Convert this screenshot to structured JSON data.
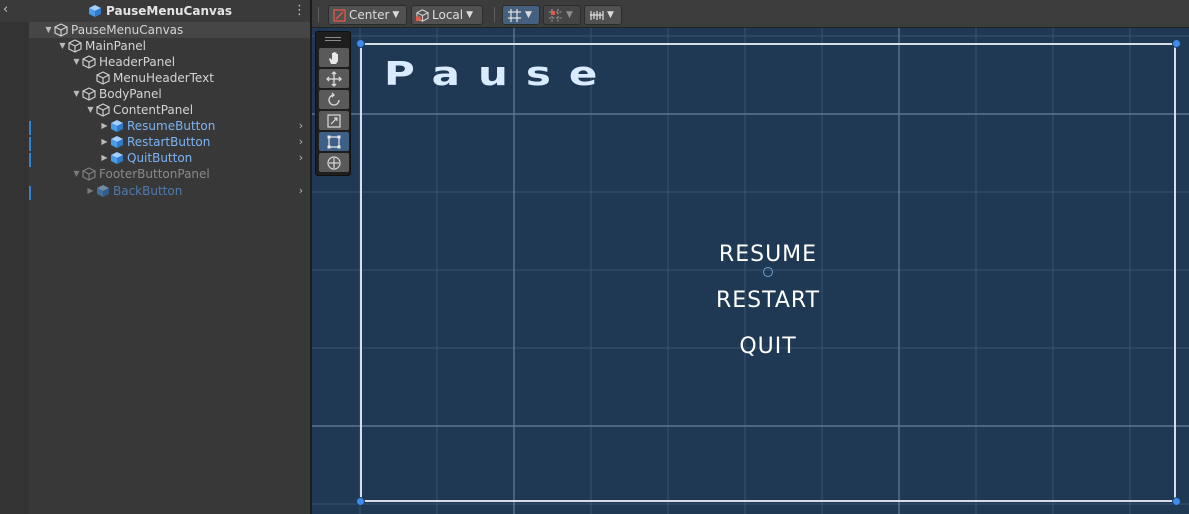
{
  "hierarchy": {
    "title": "PauseMenuCanvas",
    "rows": [
      {
        "label": "PauseMenuCanvas"
      },
      {
        "label": "MainPanel"
      },
      {
        "label": "HeaderPanel"
      },
      {
        "label": "MenuHeaderText"
      },
      {
        "label": "BodyPanel"
      },
      {
        "label": "ContentPanel"
      },
      {
        "label": "ResumeButton"
      },
      {
        "label": "RestartButton"
      },
      {
        "label": "QuitButton"
      },
      {
        "label": "FooterButtonPanel"
      },
      {
        "label": "BackButton"
      }
    ]
  },
  "toolbar": {
    "pivot_label": "Center",
    "space_label": "Local"
  },
  "scene": {
    "header_text": "Pause",
    "buttons": [
      "RESUME",
      "RESTART",
      "QUIT"
    ]
  },
  "colors": {
    "scene_background": "#1f3853",
    "prefab_text": "#7bb4f5",
    "handle": "#3f8bea"
  }
}
